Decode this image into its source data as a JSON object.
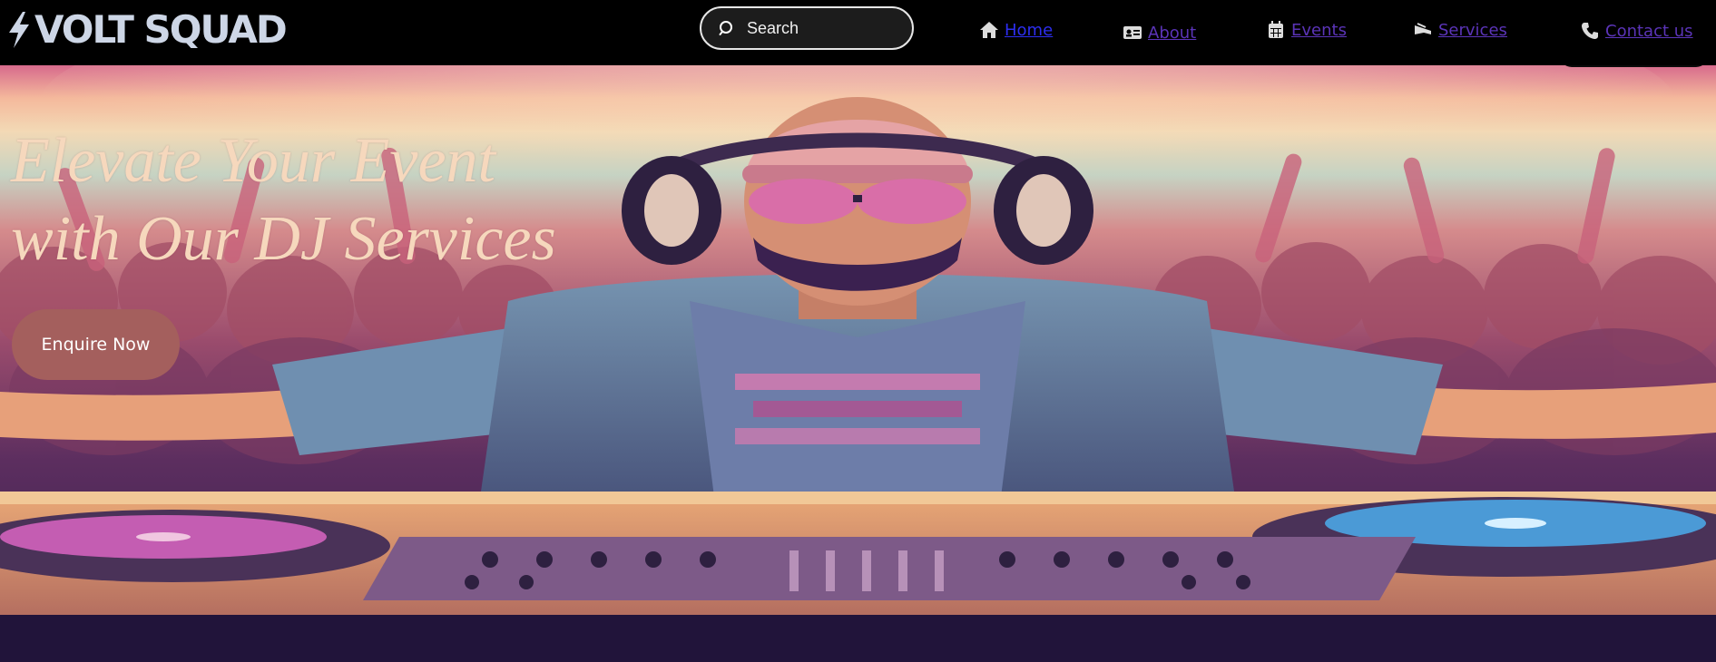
{
  "brand": {
    "name": "VOLT SQUAD",
    "icon": "lightning-bolt-icon"
  },
  "search": {
    "placeholder": "Search",
    "icon": "search-icon"
  },
  "nav": {
    "home": {
      "label": "Home",
      "icon": "home-icon",
      "color": "#2d2ef0"
    },
    "about": {
      "label": "About",
      "icon": "id-card-icon",
      "color": "#5b34b8"
    },
    "events": {
      "label": "Events",
      "icon": "calendar-icon",
      "color": "#5b34b8"
    },
    "services": {
      "label": "Services",
      "icon": "megaphone-icon",
      "color": "#5b34b8"
    },
    "contact": {
      "label": "Contact us",
      "icon": "phone-icon",
      "color": "#5b34b8"
    }
  },
  "hero": {
    "headline_line1": "Elevate Your Event",
    "headline_line2": "with Our DJ Services",
    "cta_label": "Enquire Now",
    "image": "dj-illustration"
  },
  "colors": {
    "header_bg": "#000000",
    "headline": "#f6d8bd",
    "cta_bg": "#a45f5d",
    "floor": "#21143a"
  }
}
